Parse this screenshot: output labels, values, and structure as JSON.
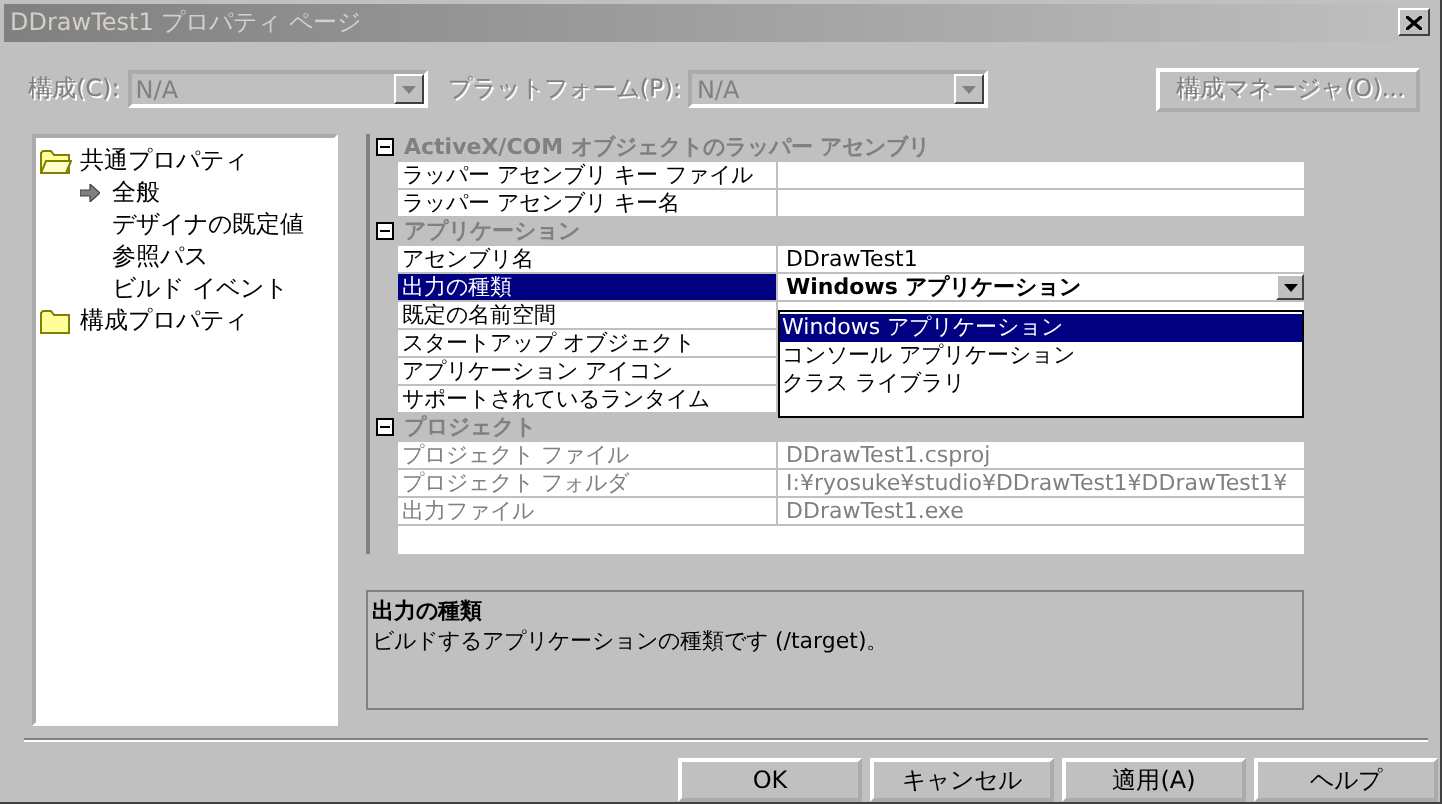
{
  "window": {
    "title": "DDrawTest1 プロパティ ページ"
  },
  "toolbar": {
    "configuration": {
      "label": "構成(C):",
      "value": "N/A",
      "disabled": true
    },
    "platform": {
      "label": "プラットフォーム(P):",
      "value": "N/A",
      "disabled": true
    },
    "manager_button": {
      "label": "構成マネージャ(O)...",
      "disabled": true
    }
  },
  "tree": [
    {
      "label": "共通プロパティ",
      "expanded": true,
      "children": [
        {
          "label": "全般",
          "selected": true
        },
        {
          "label": "デザイナの既定値",
          "selected": false
        },
        {
          "label": "参照パス",
          "selected": false
        },
        {
          "label": "ビルド イベント",
          "selected": false
        }
      ]
    },
    {
      "label": "構成プロパティ",
      "expanded": false
    }
  ],
  "grid": {
    "categories": [
      {
        "title": "ActiveX/COM オブジェクトのラッパー アセンブリ",
        "expanded": true,
        "rows": [
          {
            "name": "ラッパー アセンブリ キー ファイル",
            "selected": false,
            "disabled": false
          },
          {
            "name": "ラッパー アセンブリ キー名",
            "selected": false,
            "disabled": false
          }
        ]
      },
      {
        "title": "アプリケーション",
        "expanded": true,
        "rows": [
          {
            "name": "アセンブリ名",
            "value": "DDrawTest1",
            "selected": false,
            "disabled": false
          },
          {
            "name": "出力の種類",
            "value": "Windows アプリケーション",
            "selected": true,
            "disabled": false
          },
          {
            "name": "既定の名前空間",
            "selected": false,
            "disabled": false
          },
          {
            "name": "スタートアップ オブジェクト",
            "selected": false,
            "disabled": false
          },
          {
            "name": "アプリケーション アイコン",
            "selected": false,
            "disabled": false
          },
          {
            "name": "サポートされているランタイム",
            "selected": false,
            "disabled": false
          }
        ]
      },
      {
        "title": "プロジェクト",
        "expanded": true,
        "rows": [
          {
            "name": "プロジェクト ファイル",
            "value": "DDrawTest1.csproj",
            "selected": false,
            "disabled": true
          },
          {
            "name": "プロジェクト フォルダ",
            "value": "I:¥ryosuke¥studio¥DDrawTest1¥DDrawTest1¥",
            "selected": false,
            "disabled": true
          },
          {
            "name": "出力ファイル",
            "value": "DDrawTest1.exe",
            "selected": false,
            "disabled": true
          }
        ]
      }
    ]
  },
  "dropdown": {
    "options": [
      {
        "label": "Windows アプリケーション",
        "selected": true
      },
      {
        "label": "コンソール アプリケーション",
        "selected": false
      },
      {
        "label": "クラス ライブラリ",
        "selected": false
      }
    ]
  },
  "description": {
    "title": "出力の種類",
    "text": "ビルドするアプリケーションの種類です (/target)。"
  },
  "buttons": [
    {
      "label": "OK"
    },
    {
      "label": "キャンセル"
    },
    {
      "label": "適用(A)"
    },
    {
      "label": "ヘルプ"
    }
  ]
}
